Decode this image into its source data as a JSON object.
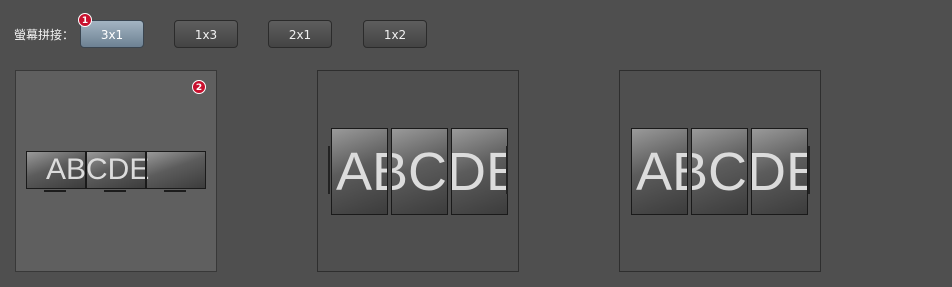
{
  "splice": {
    "label": "螢幕拼接：",
    "buttons": [
      "3x1",
      "1x3",
      "2x1",
      "1x2"
    ],
    "active": "3x1"
  },
  "badges": [
    "1",
    "2"
  ],
  "panels": [
    {
      "text": "ABCDE",
      "layout": "3x1-horizontal",
      "selected": true
    },
    {
      "text": "ABCDE",
      "layout": "3x1-vertical",
      "selected": false
    },
    {
      "text": "ABCDE",
      "layout": "3x1-vertical",
      "selected": false
    }
  ],
  "colors": {
    "background": "#4f4f4f",
    "active_button": "#8a9dac",
    "badge": "#c8102e"
  }
}
